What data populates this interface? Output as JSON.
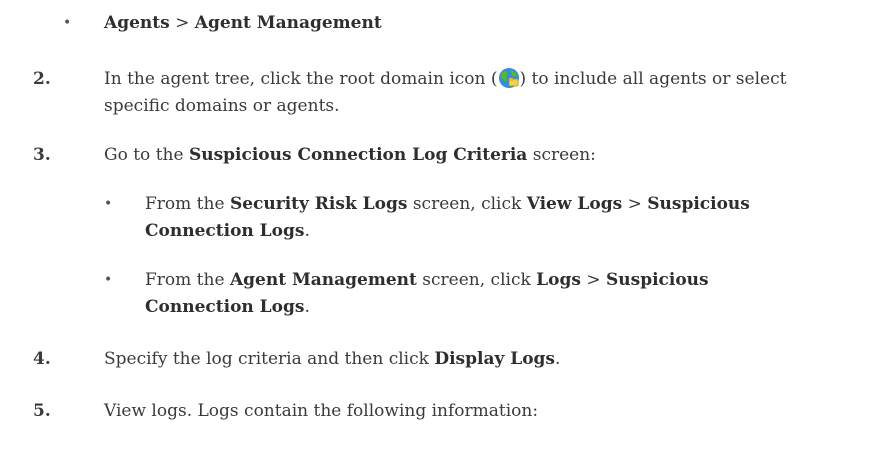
{
  "bullet_char": "•",
  "top_bullet": {
    "term1": "Agents",
    "sep": " > ",
    "term2": "Agent Management"
  },
  "step2": {
    "num": "2.",
    "line1_pre": "In the agent tree, click the root domain icon (",
    "line1_post": ") to include all agents or select",
    "line2": "specific domains or agents."
  },
  "step3": {
    "num": "3.",
    "pre": "Go to the ",
    "bold": "Suspicious Connection Log Criteria",
    "post": " screen:",
    "sub1": {
      "pre": "From the ",
      "screen": "Security Risk Logs",
      "mid": " screen, click ",
      "menu1": "View Logs",
      "sep": " > ",
      "menu2a": "Suspicious",
      "menu2b": "Connection Logs",
      "end": "."
    },
    "sub2": {
      "pre": "From the ",
      "screen": "Agent Management",
      "mid": " screen, click ",
      "menu1": "Logs",
      "sep": " > ",
      "menu2a": "Suspicious",
      "menu2b": "Connection Logs",
      "end": "."
    }
  },
  "step4": {
    "num": "4.",
    "pre": "Specify the log criteria and then click ",
    "bold": "Display Logs",
    "end": "."
  },
  "step5": {
    "num": "5.",
    "text": "View logs. Logs contain the following information:"
  },
  "icon": {
    "name": "root-domain-globe-icon",
    "color_water": "#2f8fd8",
    "color_land": "#5cb531"
  }
}
